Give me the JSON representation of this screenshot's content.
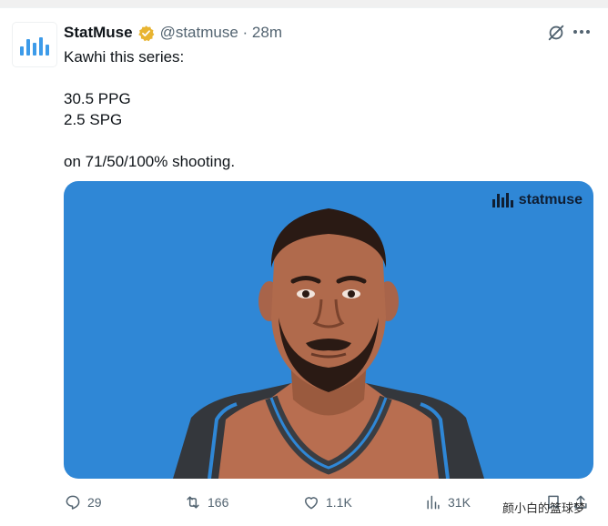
{
  "tweet": {
    "author_name": "StatMuse",
    "handle_time": "@statmuse · 28m",
    "lines": [
      "Kawhi this series:",
      "30.5 PPG",
      "2.5 SPG",
      "on 71/50/100% shooting."
    ],
    "media_watermark": "statmuse"
  },
  "actions": {
    "replies": "29",
    "retweets": "166",
    "likes": "1.1K",
    "views": "31K"
  },
  "overlay_watermark": "颜小白的篮球梦",
  "colors": {
    "media_bg": "#2f87d6",
    "verified": "#e8b431",
    "icon_gray": "#536471"
  }
}
